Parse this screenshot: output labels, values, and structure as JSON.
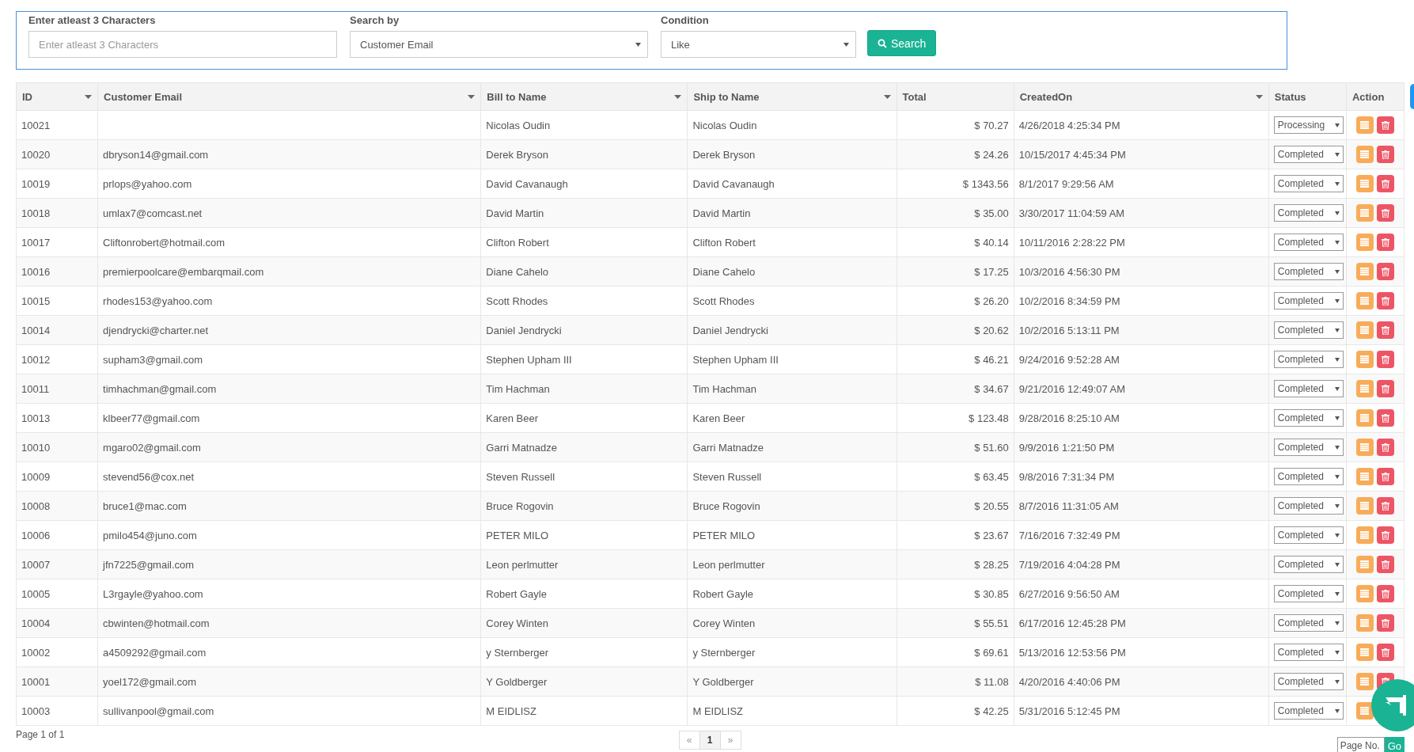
{
  "search": {
    "text_label": "Enter atleast 3 Characters",
    "text_placeholder": "Enter atleast 3 Characters",
    "by_label": "Search by",
    "by_value": "Customer Email",
    "condition_label": "Condition",
    "condition_value": "Like",
    "button": "Search"
  },
  "table": {
    "columns": [
      {
        "label": "ID",
        "sortable": true
      },
      {
        "label": "Customer Email",
        "sortable": true
      },
      {
        "label": "Bill to Name",
        "sortable": true
      },
      {
        "label": "Ship to Name",
        "sortable": true
      },
      {
        "label": "Total",
        "sortable": false
      },
      {
        "label": "CreatedOn",
        "sortable": true
      },
      {
        "label": "Status",
        "sortable": false
      },
      {
        "label": "Action",
        "sortable": false
      }
    ],
    "rows": [
      {
        "id": "10021",
        "email": "",
        "bill": "Nicolas Oudin",
        "ship": "Nicolas Oudin",
        "total": "$ 70.27",
        "created": "4/26/2018 4:25:34 PM",
        "status": "Processing"
      },
      {
        "id": "10020",
        "email": "dbryson14@gmail.com",
        "bill": "Derek Bryson",
        "ship": "Derek Bryson",
        "total": "$ 24.26",
        "created": "10/15/2017 4:45:34 PM",
        "status": "Completed"
      },
      {
        "id": "10019",
        "email": "prlops@yahoo.com",
        "bill": "David Cavanaugh",
        "ship": "David Cavanaugh",
        "total": "$ 1343.56",
        "created": "8/1/2017 9:29:56 AM",
        "status": "Completed"
      },
      {
        "id": "10018",
        "email": "umlax7@comcast.net",
        "bill": "David Martin",
        "ship": "David Martin",
        "total": "$ 35.00",
        "created": "3/30/2017 11:04:59 AM",
        "status": "Completed"
      },
      {
        "id": "10017",
        "email": "Cliftonrobert@hotmail.com",
        "bill": "Clifton Robert",
        "ship": "Clifton Robert",
        "total": "$ 40.14",
        "created": "10/11/2016 2:28:22 PM",
        "status": "Completed"
      },
      {
        "id": "10016",
        "email": "premierpoolcare@embarqmail.com",
        "bill": "Diane Cahelo",
        "ship": "Diane Cahelo",
        "total": "$ 17.25",
        "created": "10/3/2016 4:56:30 PM",
        "status": "Completed"
      },
      {
        "id": "10015",
        "email": "rhodes153@yahoo.com",
        "bill": "Scott Rhodes",
        "ship": "Scott Rhodes",
        "total": "$ 26.20",
        "created": "10/2/2016 8:34:59 PM",
        "status": "Completed"
      },
      {
        "id": "10014",
        "email": "djendrycki@charter.net",
        "bill": "Daniel Jendrycki",
        "ship": "Daniel Jendrycki",
        "total": "$ 20.62",
        "created": "10/2/2016 5:13:11 PM",
        "status": "Completed"
      },
      {
        "id": "10012",
        "email": "supham3@gmail.com",
        "bill": "Stephen Upham III",
        "ship": "Stephen Upham III",
        "total": "$ 46.21",
        "created": "9/24/2016 9:52:28 AM",
        "status": "Completed"
      },
      {
        "id": "10011",
        "email": "timhachman@gmail.com",
        "bill": "Tim Hachman",
        "ship": "Tim Hachman",
        "total": "$ 34.67",
        "created": "9/21/2016 12:49:07 AM",
        "status": "Completed"
      },
      {
        "id": "10013",
        "email": "klbeer77@gmail.com",
        "bill": "Karen Beer",
        "ship": "Karen Beer",
        "total": "$ 123.48",
        "created": "9/28/2016 8:25:10 AM",
        "status": "Completed"
      },
      {
        "id": "10010",
        "email": "mgaro02@gmail.com",
        "bill": "Garri Matnadze",
        "ship": "Garri Matnadze",
        "total": "$ 51.60",
        "created": "9/9/2016 1:21:50 PM",
        "status": "Completed"
      },
      {
        "id": "10009",
        "email": "stevend56@cox.net",
        "bill": "Steven Russell",
        "ship": "Steven Russell",
        "total": "$ 63.45",
        "created": "9/8/2016 7:31:34 PM",
        "status": "Completed"
      },
      {
        "id": "10008",
        "email": "bruce1@mac.com",
        "bill": "Bruce Rogovin",
        "ship": "Bruce Rogovin",
        "total": "$ 20.55",
        "created": "8/7/2016 11:31:05 AM",
        "status": "Completed"
      },
      {
        "id": "10006",
        "email": "pmilo454@juno.com",
        "bill": "PETER MILO",
        "ship": "PETER MILO",
        "total": "$ 23.67",
        "created": "7/16/2016 7:32:49 PM",
        "status": "Completed"
      },
      {
        "id": "10007",
        "email": "jfn7225@gmail.com",
        "bill": "Leon perlmutter",
        "ship": "Leon perlmutter",
        "total": "$ 28.25",
        "created": "7/19/2016 4:04:28 PM",
        "status": "Completed"
      },
      {
        "id": "10005",
        "email": "L3rgayle@yahoo.com",
        "bill": "Robert Gayle",
        "ship": "Robert Gayle",
        "total": "$ 30.85",
        "created": "6/27/2016 9:56:50 AM",
        "status": "Completed"
      },
      {
        "id": "10004",
        "email": "cbwinten@hotmail.com",
        "bill": "Corey Winten",
        "ship": "Corey Winten",
        "total": "$ 55.51",
        "created": "6/17/2016 12:45:28 PM",
        "status": "Completed"
      },
      {
        "id": "10002",
        "email": "a4509292@gmail.com",
        "bill": "y Sternberger",
        "ship": "y Sternberger",
        "total": "$ 69.61",
        "created": "5/13/2016 12:53:56 PM",
        "status": "Completed"
      },
      {
        "id": "10001",
        "email": "yoel172@gmail.com",
        "bill": "Y Goldberger",
        "ship": "Y Goldberger",
        "total": "$ 11.08",
        "created": "4/20/2016 4:40:06 PM",
        "status": "Completed"
      },
      {
        "id": "10003",
        "email": "sullivanpool@gmail.com",
        "bill": "M EIDLISZ",
        "ship": "M EIDLISZ",
        "total": "$ 42.25",
        "created": "5/31/2016 5:12:45 PM",
        "status": "Completed"
      }
    ]
  },
  "footer": {
    "page_info": "Page 1 of 1",
    "pages": [
      {
        "label": "«",
        "selected": false
      },
      {
        "label": "1",
        "selected": true
      },
      {
        "label": "»",
        "selected": false
      }
    ],
    "page_no_placeholder": "Page No.",
    "go": "Go"
  }
}
